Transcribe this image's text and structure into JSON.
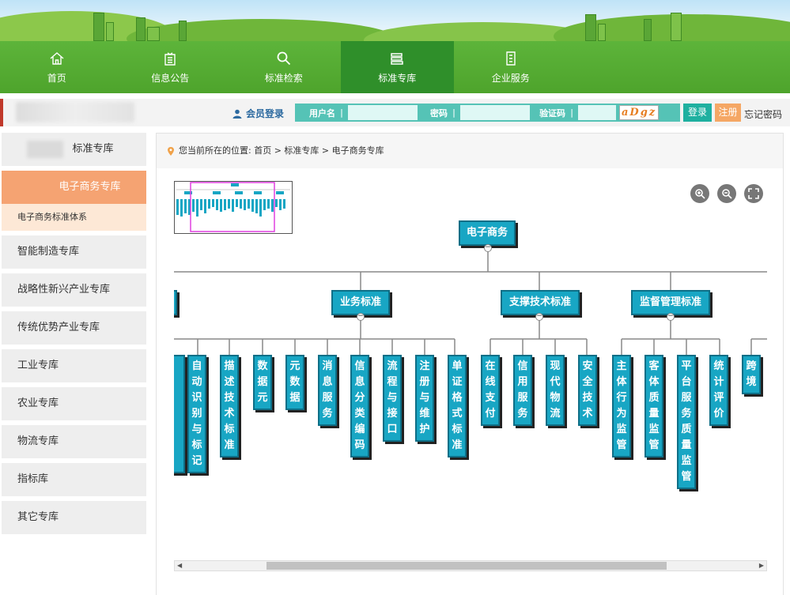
{
  "nav": {
    "items": [
      {
        "label": "首页",
        "icon": "home-icon"
      },
      {
        "label": "信息公告",
        "icon": "notice-icon"
      },
      {
        "label": "标准检索",
        "icon": "search-icon"
      },
      {
        "label": "标准专库",
        "icon": "books-icon",
        "active": true
      },
      {
        "label": "企业服务",
        "icon": "document-icon"
      }
    ]
  },
  "member": {
    "title": "会员登录",
    "username_label": "用户名",
    "password_label": "密码",
    "captcha_label": "验证码",
    "captcha_text": "aDgz",
    "login_button": "登录",
    "register_button": "注册",
    "forgot_link": "忘记密码"
  },
  "sidebar": {
    "top_item": "标准专库",
    "active_item": "电子商务专库",
    "sub_item": "电子商务标准体系",
    "items": [
      "智能制造专库",
      "战略性新兴产业专库",
      "传统优势产业专库",
      "工业专库",
      "农业专库",
      "物流专库",
      "指标库",
      "其它专库"
    ]
  },
  "breadcrumb": {
    "text": "您当前所在的位置: 首页 > 标准专库 > 电子商务专库"
  },
  "tree": {
    "root": "电子商务",
    "groups": [
      {
        "label": "业务标准",
        "children": [
          "数据元",
          "元数据",
          "消息服务",
          "信息分类编码",
          "流程与接口",
          "注册与维护",
          "单证格式标准"
        ]
      },
      {
        "label": "支撑技术标准",
        "children": [
          "在线支付",
          "信用服务",
          "现代物流",
          "安全技术"
        ]
      },
      {
        "label": "监督管理标准",
        "children": [
          "主体行为监管",
          "客体质量监管",
          "平台服务质量监管",
          "统计评价"
        ]
      }
    ],
    "left_partial_children": [
      "自动识别与标记",
      "描述技术标准"
    ],
    "right_partial": "跨境"
  }
}
